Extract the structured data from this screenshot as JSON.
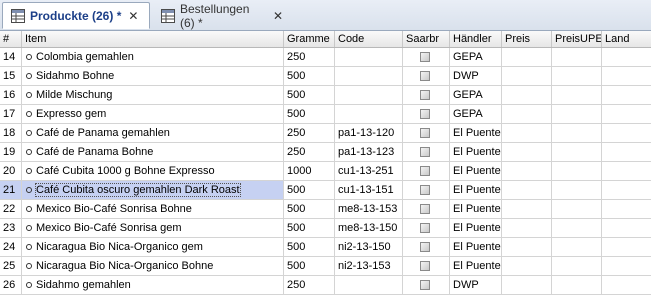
{
  "tabs": [
    {
      "label": "Produckte (26) *",
      "close": "✕"
    },
    {
      "label": "Bestellungen (6) *",
      "close": "✕"
    }
  ],
  "columns": {
    "num": "#",
    "item": "Item",
    "gramme": "Gramme",
    "code": "Code",
    "saarbr": "Saarbr",
    "haendler": "Händler",
    "preis": "Preis",
    "preisupe": "PreisUPE",
    "land": "Land"
  },
  "rows": [
    {
      "num": "14",
      "item": "Colombia gemahlen",
      "gramme": "250",
      "code": "",
      "haendler": "GEPA",
      "preis": "",
      "preisupe": "",
      "land": ""
    },
    {
      "num": "15",
      "item": "Sidahmo Bohne",
      "gramme": "500",
      "code": "",
      "haendler": "DWP",
      "preis": "",
      "preisupe": "",
      "land": ""
    },
    {
      "num": "16",
      "item": "Milde Mischung",
      "gramme": "500",
      "code": "",
      "haendler": "GEPA",
      "preis": "",
      "preisupe": "",
      "land": ""
    },
    {
      "num": "17",
      "item": "Expresso gem",
      "gramme": "500",
      "code": "",
      "haendler": "GEPA",
      "preis": "",
      "preisupe": "",
      "land": ""
    },
    {
      "num": "18",
      "item": "Café de Panama gemahlen",
      "gramme": "250",
      "code": "pa1-13-120",
      "haendler": "El Puente",
      "preis": "",
      "preisupe": "",
      "land": ""
    },
    {
      "num": "19",
      "item": "Café de Panama Bohne",
      "gramme": "250",
      "code": "pa1-13-123",
      "haendler": "El Puente",
      "preis": "",
      "preisupe": "",
      "land": ""
    },
    {
      "num": "20",
      "item": "Café Cubita 1000 g Bohne Expresso",
      "gramme": "1000",
      "code": "cu1-13-251",
      "haendler": "El Puente",
      "preis": "",
      "preisupe": "",
      "land": ""
    },
    {
      "num": "21",
      "item": "Café Cubita oscuro gemahlen Dark Roast",
      "gramme": "500",
      "code": "cu1-13-151",
      "haendler": "El Puente",
      "preis": "",
      "preisupe": "",
      "land": "",
      "selected": true
    },
    {
      "num": "22",
      "item": "Mexico Bio-Café Sonrisa Bohne",
      "gramme": "500",
      "code": "me8-13-153",
      "haendler": "El Puente",
      "preis": "",
      "preisupe": "",
      "land": ""
    },
    {
      "num": "23",
      "item": "Mexico Bio-Café Sonrisa gem",
      "gramme": "500",
      "code": "me8-13-150",
      "haendler": "El Puente",
      "preis": "",
      "preisupe": "",
      "land": ""
    },
    {
      "num": "24",
      "item": "Nicaragua Bio Nica-Organico gem",
      "gramme": "500",
      "code": "ni2-13-150",
      "haendler": "El Puente",
      "preis": "",
      "preisupe": "",
      "land": ""
    },
    {
      "num": "25",
      "item": "Nicaragua Bio Nica-Organico Bohne",
      "gramme": "500",
      "code": "ni2-13-153",
      "haendler": "El Puente",
      "preis": "",
      "preisupe": "",
      "land": ""
    },
    {
      "num": "26",
      "item": "Sidahmo gemahlen",
      "gramme": "250",
      "code": "",
      "haendler": "DWP",
      "preis": "",
      "preisupe": "",
      "land": ""
    }
  ]
}
